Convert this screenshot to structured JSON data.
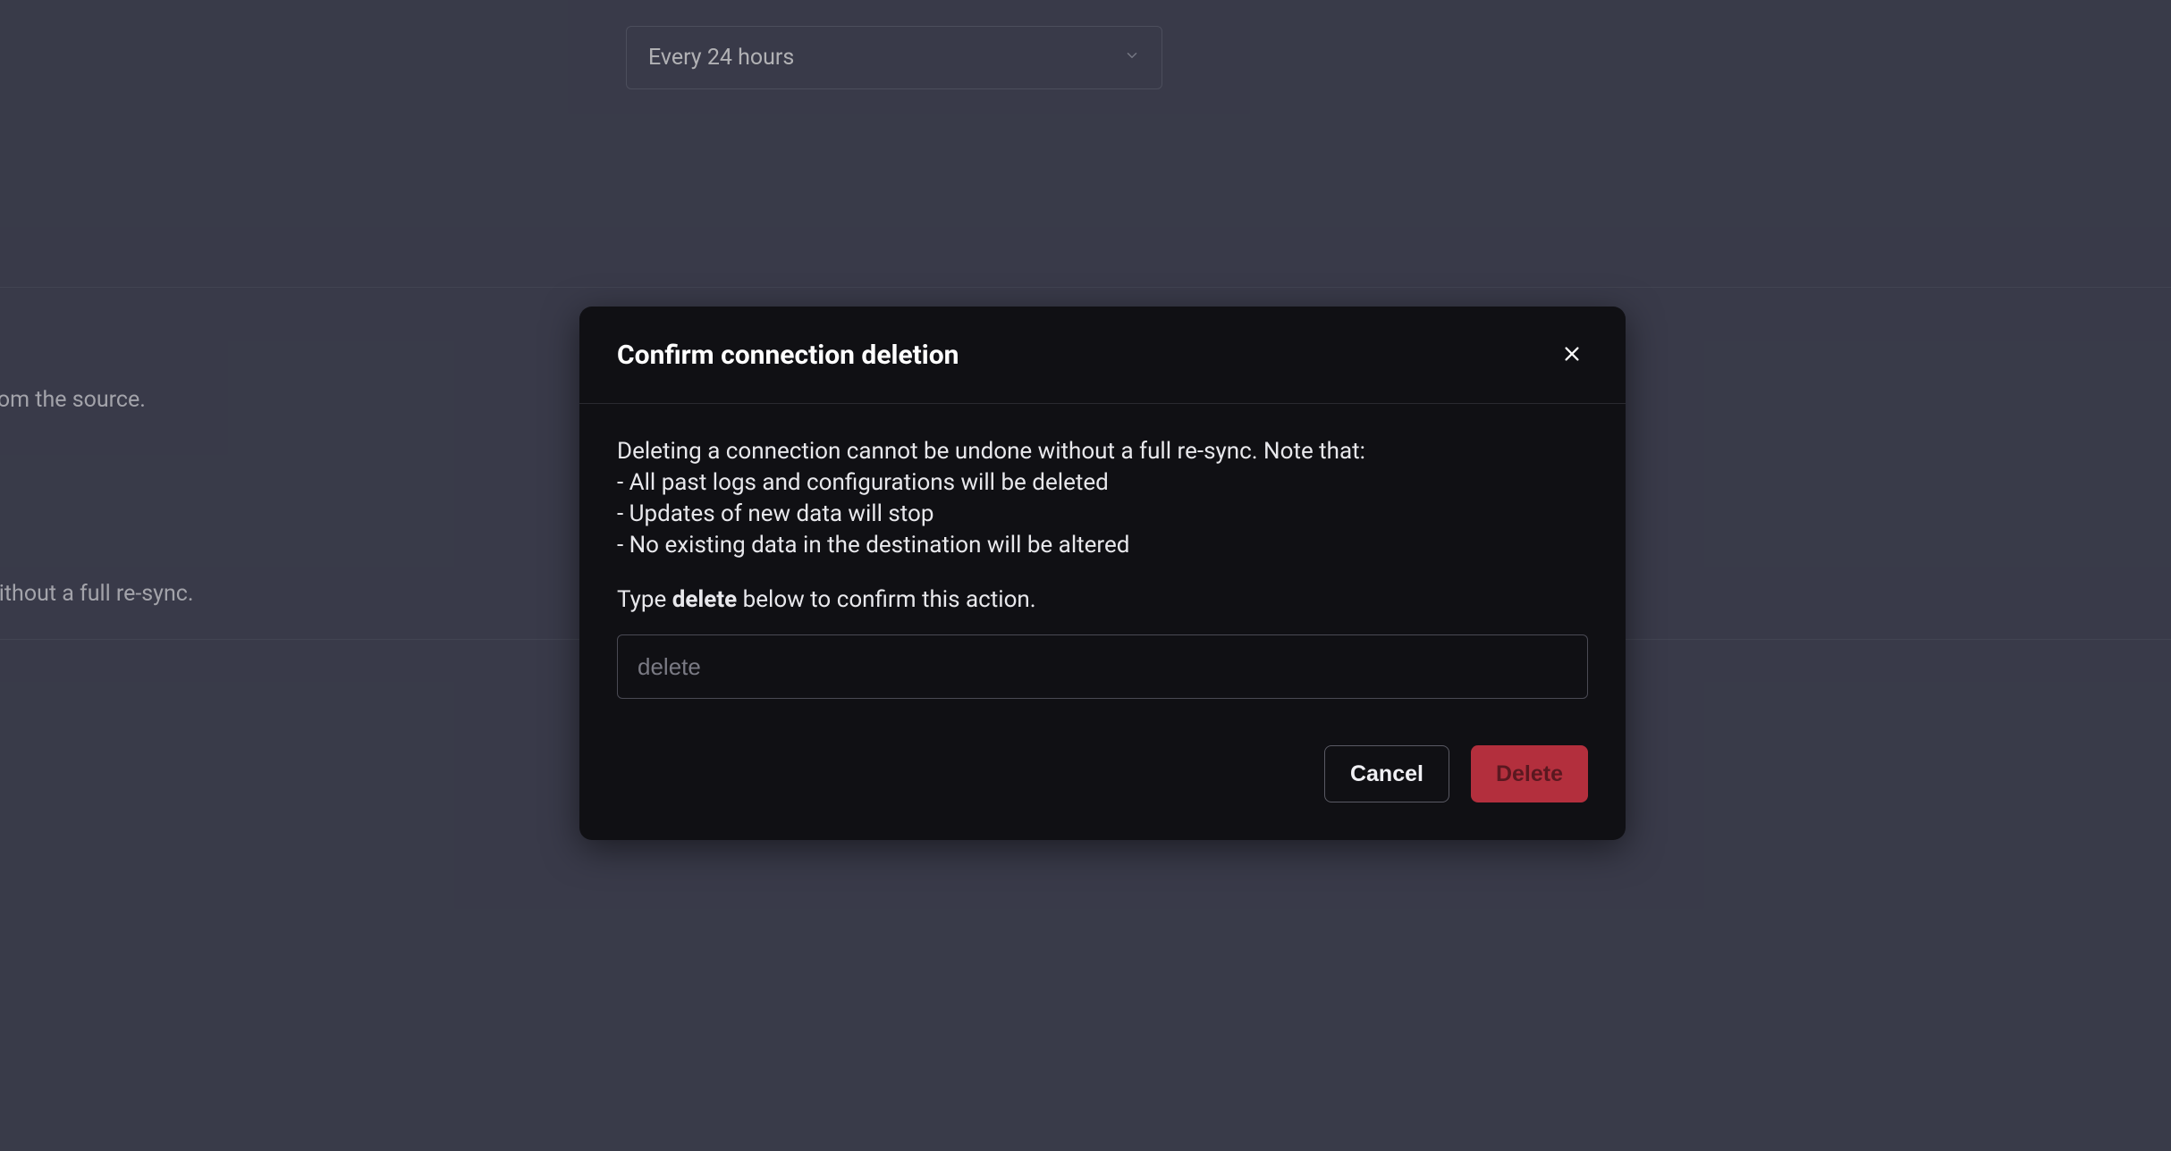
{
  "background": {
    "dropdown_value": "Every 24 hours",
    "text_fragment_1": "from the source.",
    "text_fragment_2": "without a full re-sync."
  },
  "modal": {
    "title": "Confirm connection deletion",
    "description_intro": "Deleting a connection cannot be undone without a full re-sync. Note that:",
    "bullet_1": "- All past logs and configurations will be deleted",
    "bullet_2": "- Updates of new data will stop",
    "bullet_3": "- No existing data in the destination will be altered",
    "confirm_prefix": "Type ",
    "confirm_keyword": "delete",
    "confirm_suffix": " below to confirm this action.",
    "input_placeholder": "delete",
    "input_value": "",
    "cancel_label": "Cancel",
    "delete_label": "Delete"
  }
}
